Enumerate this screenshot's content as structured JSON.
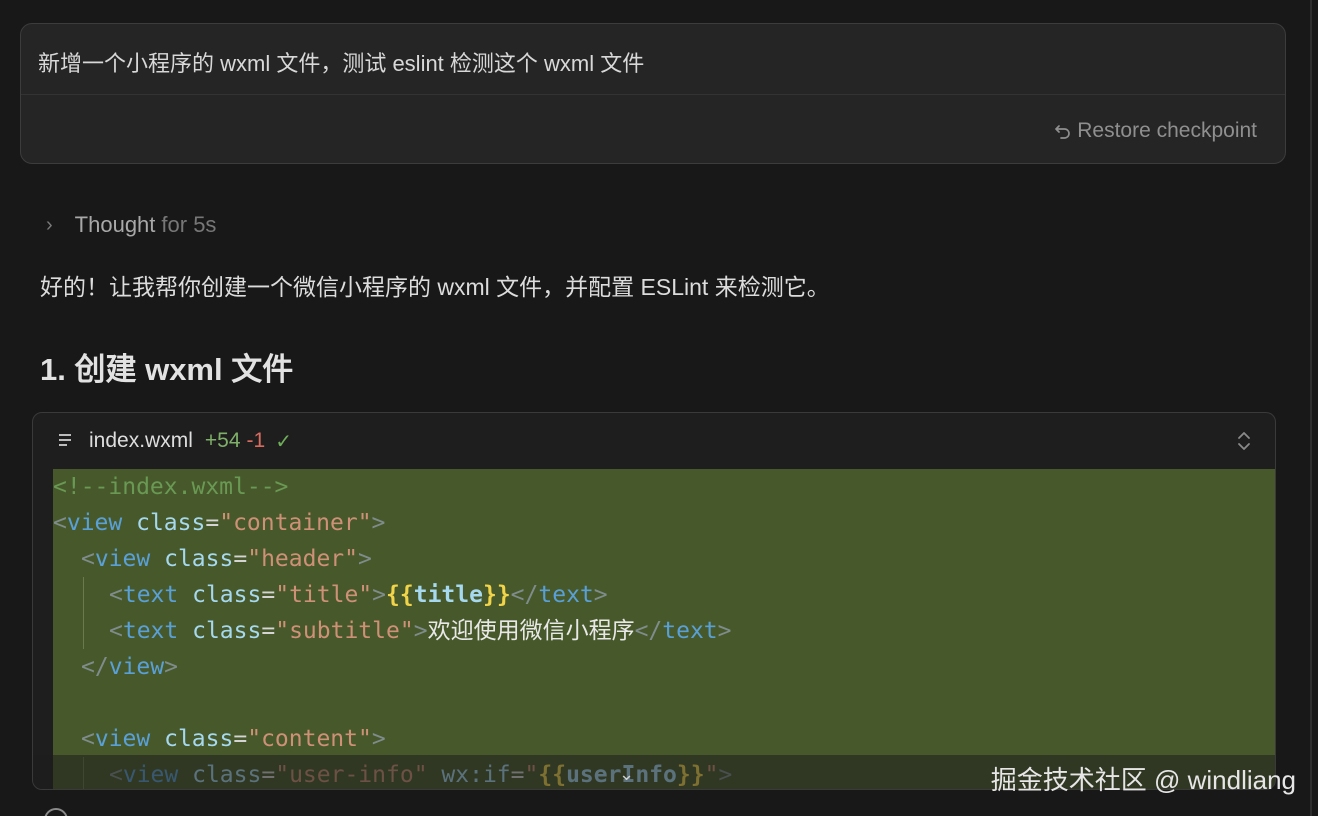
{
  "prompt": {
    "text": "新增一个小程序的 wxml 文件，测试 eslint 检测这个 wxml 文件",
    "restore_label": "Restore checkpoint"
  },
  "thought": {
    "label": "Thought",
    "duration": "for 5s"
  },
  "answer_text": "好的！让我帮你创建一个微信小程序的 wxml 文件，并配置 ESLint 来检测它。",
  "heading": "1. 创建 wxml 文件",
  "code_block": {
    "file_name": "index.wxml",
    "additions": "+54",
    "deletions": "-1",
    "status_icon": "check-icon",
    "highlight_color": "#47592a",
    "lines": [
      {
        "indent": 0,
        "tokens": [
          {
            "c": "cmt",
            "t": "<!--index.wxml-->"
          }
        ]
      },
      {
        "indent": 0,
        "tokens": [
          {
            "c": "punct",
            "t": "<"
          },
          {
            "c": "tag",
            "t": "view"
          },
          {
            "c": "eq",
            "t": " "
          },
          {
            "c": "attr",
            "t": "class"
          },
          {
            "c": "eq",
            "t": "="
          },
          {
            "c": "str",
            "t": "\"container\""
          },
          {
            "c": "punct",
            "t": ">"
          }
        ]
      },
      {
        "indent": 1,
        "tokens": [
          {
            "c": "punct",
            "t": "<"
          },
          {
            "c": "tag",
            "t": "view"
          },
          {
            "c": "eq",
            "t": " "
          },
          {
            "c": "attr",
            "t": "class"
          },
          {
            "c": "eq",
            "t": "="
          },
          {
            "c": "str",
            "t": "\"header\""
          },
          {
            "c": "punct",
            "t": ">"
          }
        ]
      },
      {
        "indent": 2,
        "tokens": [
          {
            "c": "punct",
            "t": "<"
          },
          {
            "c": "tag",
            "t": "text"
          },
          {
            "c": "eq",
            "t": " "
          },
          {
            "c": "attr",
            "t": "class"
          },
          {
            "c": "eq",
            "t": "="
          },
          {
            "c": "str",
            "t": "\"title\""
          },
          {
            "c": "punct",
            "t": ">"
          },
          {
            "c": "brace",
            "t": "{{"
          },
          {
            "c": "bind",
            "t": "title"
          },
          {
            "c": "brace",
            "t": "}}"
          },
          {
            "c": "punct",
            "t": "</"
          },
          {
            "c": "tag",
            "t": "text"
          },
          {
            "c": "punct",
            "t": ">"
          }
        ]
      },
      {
        "indent": 2,
        "tokens": [
          {
            "c": "punct",
            "t": "<"
          },
          {
            "c": "tag",
            "t": "text"
          },
          {
            "c": "eq",
            "t": " "
          },
          {
            "c": "attr",
            "t": "class"
          },
          {
            "c": "eq",
            "t": "="
          },
          {
            "c": "str",
            "t": "\"subtitle\""
          },
          {
            "c": "punct",
            "t": ">"
          },
          {
            "c": "txt",
            "t": "欢迎使用微信小程序"
          },
          {
            "c": "punct",
            "t": "</"
          },
          {
            "c": "tag",
            "t": "text"
          },
          {
            "c": "punct",
            "t": ">"
          }
        ]
      },
      {
        "indent": 1,
        "tokens": [
          {
            "c": "punct",
            "t": "</"
          },
          {
            "c": "tag",
            "t": "view"
          },
          {
            "c": "punct",
            "t": ">"
          }
        ]
      },
      {
        "indent": 0,
        "tokens": []
      },
      {
        "indent": 1,
        "tokens": [
          {
            "c": "punct",
            "t": "<"
          },
          {
            "c": "tag",
            "t": "view"
          },
          {
            "c": "eq",
            "t": " "
          },
          {
            "c": "attr",
            "t": "class"
          },
          {
            "c": "eq",
            "t": "="
          },
          {
            "c": "str",
            "t": "\"content\""
          },
          {
            "c": "punct",
            "t": ">"
          }
        ]
      },
      {
        "indent": 2,
        "tokens": [
          {
            "c": "punct",
            "t": "<"
          },
          {
            "c": "tag",
            "t": "view"
          },
          {
            "c": "eq",
            "t": " "
          },
          {
            "c": "attr",
            "t": "class"
          },
          {
            "c": "eq",
            "t": "="
          },
          {
            "c": "str",
            "t": "\"user-info\""
          },
          {
            "c": "eq",
            "t": " "
          },
          {
            "c": "attr",
            "t": "wx:if"
          },
          {
            "c": "eq",
            "t": "="
          },
          {
            "c": "str",
            "t": "\""
          },
          {
            "c": "brace",
            "t": "{{"
          },
          {
            "c": "bind",
            "t": "userInfo"
          },
          {
            "c": "brace",
            "t": "}}"
          },
          {
            "c": "str",
            "t": "\""
          },
          {
            "c": "punct",
            "t": ">"
          }
        ]
      }
    ]
  },
  "watermark": "掘金技术社区 @ windliang"
}
